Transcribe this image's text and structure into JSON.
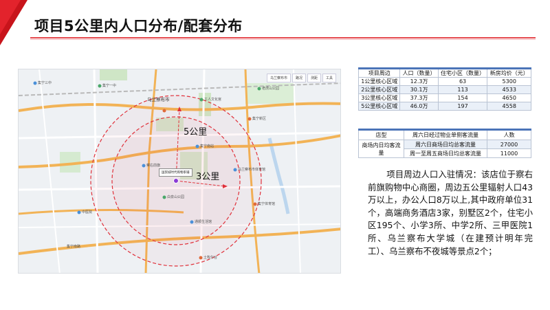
{
  "header": {
    "title": "项目5公里内人口分布/配套分布"
  },
  "colors": {
    "accent": "#e3232c",
    "table_header_bar": "#4b74b8",
    "ring": "#e0303a"
  },
  "map": {
    "ring_labels": {
      "outer": "5公里",
      "inner": "3公里"
    },
    "center_label": "国贸城时代购物系铺",
    "city_label": "乌兰察布市",
    "toolbar": [
      "乌兰察布市",
      "路况",
      "测距",
      "工具"
    ],
    "place_labels": [
      "集宁三中",
      "集宁一中",
      "乌兰察布市",
      "工人文化宫",
      "老虎山公园",
      "集宁新区",
      "察右前旗",
      "集宁南站",
      "白泉山公园",
      "乌兰察布市体育馆",
      "集宁体育馆",
      "通顺生活馆",
      "中医院",
      "集宁四中",
      "集宁南路",
      "奥体公园",
      "土牧尔台"
    ]
  },
  "population_table": {
    "headers": [
      "项目周边",
      "人口（数量）",
      "住宅小区（数量）",
      "新房均价（元）"
    ],
    "rows": [
      [
        "1公里核心区域",
        "12.3万",
        "63",
        "5300"
      ],
      [
        "2公里核心区域",
        "30.1万",
        "113",
        "4533"
      ],
      [
        "3公里核心区域",
        "37.3万",
        "154",
        "4650"
      ],
      [
        "5公里核心区域",
        "46.0万",
        "197",
        "4558"
      ]
    ]
  },
  "traffic_table": {
    "headers": [
      "店型",
      "周六日经过物业单侧客流量",
      "人数"
    ],
    "row_label": "商场内日均客流量",
    "rows": [
      [
        "周六日商场日均总客流量",
        "27000"
      ],
      [
        "周一至周五商场日均总客流量",
        "11000"
      ]
    ]
  },
  "description": "项目周边人口入驻情况：该店位于察右前旗购物中心商圈，周边五公里辐射人口43万以上，办公人口8万以上,其中政府单位31个，高端商务酒店3家，别墅区2个，住宅小区195个、小学3所、中学2所、三甲医院1所、乌兰察布大学城（在建预计明年完工）、乌兰察布不夜城等景点2个；"
}
